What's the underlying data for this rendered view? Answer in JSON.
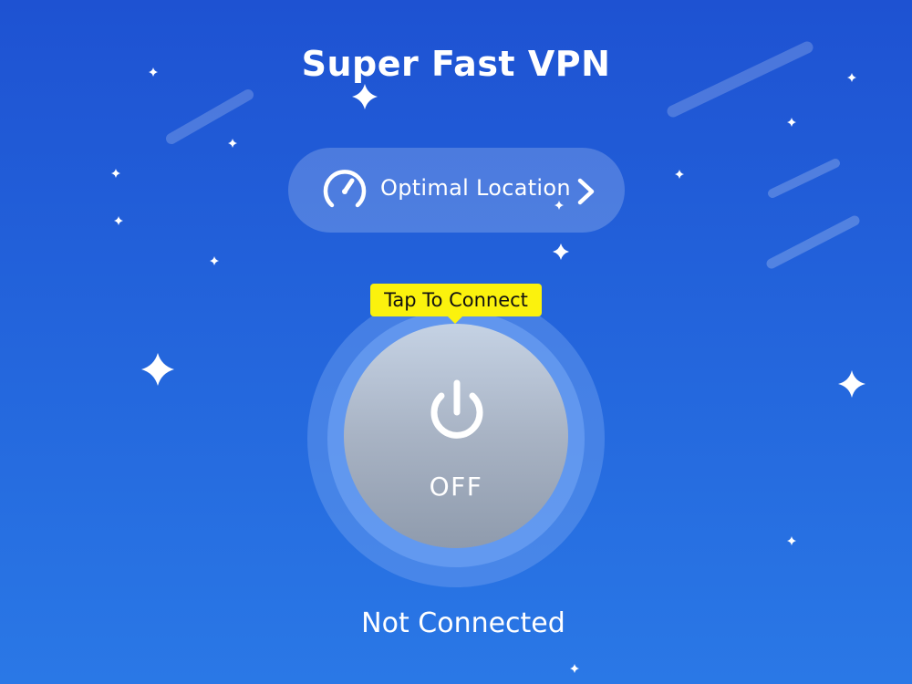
{
  "app": {
    "title": "Super Fast VPN"
  },
  "location_selector": {
    "label": "Optimal Location",
    "icon": "speedometer-icon",
    "chevron_icon": "chevron-right-icon"
  },
  "connect_button": {
    "tooltip": "Tap To Connect",
    "state_label": "OFF",
    "icon": "power-icon"
  },
  "status": {
    "text": "Not Connected"
  },
  "colors": {
    "background": "#1e52d2",
    "tooltip": "#fbf20d",
    "button_top": "#c5d2e4",
    "button_bottom": "#8f9bad",
    "text": "#ffffff"
  }
}
